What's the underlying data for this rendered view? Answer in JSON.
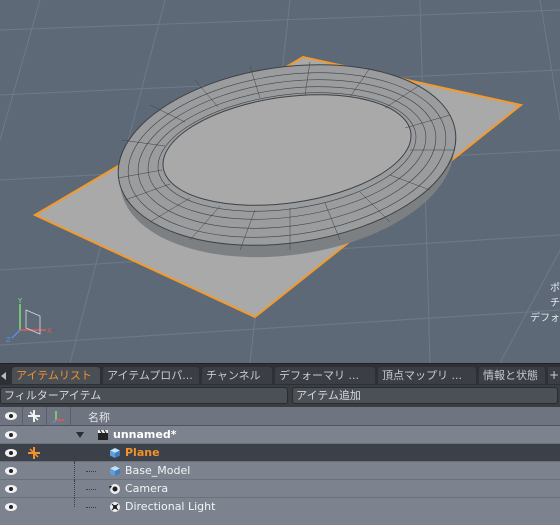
{
  "viewport": {
    "hud_lines": [
      "ポ",
      "チ",
      "デフォ"
    ],
    "axis_labels": {
      "y": "Y",
      "z": "Z",
      "x": "X"
    },
    "colors": {
      "background": "#5e6978",
      "plane_fill": "#a9a9a9",
      "plane_outline": "#f39a2a",
      "mesh_fill": "#9a9c9e",
      "mesh_wire": "#3e4247"
    }
  },
  "tabs": [
    {
      "label": "アイテムリスト",
      "active": true
    },
    {
      "label": "アイテムプロパ...",
      "active": false
    },
    {
      "label": "チャンネル",
      "active": false
    },
    {
      "label": "デフォーマリ ...",
      "active": false
    },
    {
      "label": "頂点マップリ ...",
      "active": false
    },
    {
      "label": "情報と状態",
      "active": false
    }
  ],
  "tab_plus": "+",
  "filter": {
    "placeholder": "フィルターアイテム"
  },
  "add_item": {
    "label": "アイテム追加"
  },
  "columns": {
    "name_header": "名称"
  },
  "items": [
    {
      "label": "unnamed*",
      "icon": "scene-clapper-icon"
    },
    {
      "label": "Plane",
      "icon": "mesh-cube-icon",
      "selected": true
    },
    {
      "label": "Base_Model",
      "icon": "mesh-cube-icon"
    },
    {
      "label": "Camera",
      "icon": "camera-icon"
    },
    {
      "label": "Directional Light",
      "icon": "light-icon"
    }
  ],
  "accent": "#f3922a"
}
